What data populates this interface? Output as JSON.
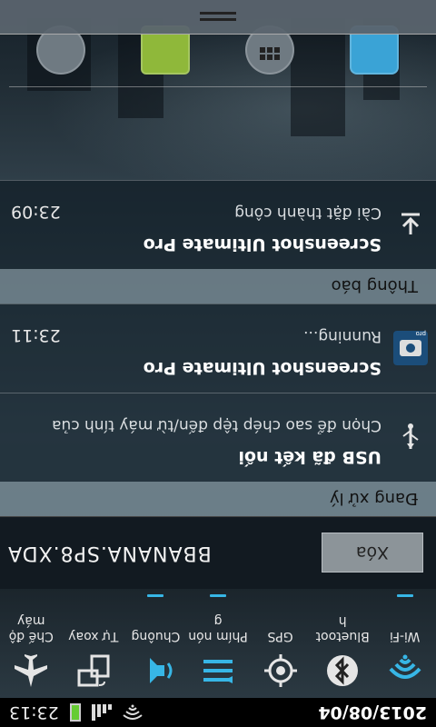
{
  "status_bar": {
    "date": "2013/08/04",
    "time": "23:13"
  },
  "quick_toggles": [
    {
      "label": "Wi-Fi",
      "icon": "wifi-icon",
      "on": true
    },
    {
      "label": "Bluetooth",
      "icon": "bluetooth-icon",
      "on": false
    },
    {
      "label": "GPS",
      "icon": "gps-icon",
      "on": false
    },
    {
      "label": "Phím nóng",
      "icon": "hotkey-icon",
      "on": true
    },
    {
      "label": "Chuông",
      "icon": "ringer-icon",
      "on": true
    },
    {
      "label": "Tự xoay",
      "icon": "auto-rotate-icon",
      "on": false
    },
    {
      "label": "Chế độ máy",
      "icon": "airplane-icon",
      "on": false
    }
  ],
  "carrier": {
    "name": "BBANANA.SP8.XDA",
    "clear_label": "Xóa"
  },
  "sections": {
    "ongoing": "Đang xử lý",
    "notifications": "Thông báo"
  },
  "notifications": [
    {
      "title": "USB đã kết nối",
      "subtitle": "Chọn để sao chép tệp đến/từ máy tính của",
      "time": "",
      "icon": "usb-icon"
    },
    {
      "title": "Screenshot Ultimate Pro",
      "subtitle": "Running...",
      "time": "23:11",
      "icon": "screenshot-app-icon",
      "badge": "pro"
    },
    {
      "title": "Screenshot Ultimate Pro",
      "subtitle": "Cài đặt thành công",
      "time": "23:09",
      "icon": "download-icon"
    }
  ],
  "colors": {
    "accent": "#37b6e6",
    "section_header": "#7e909a"
  }
}
